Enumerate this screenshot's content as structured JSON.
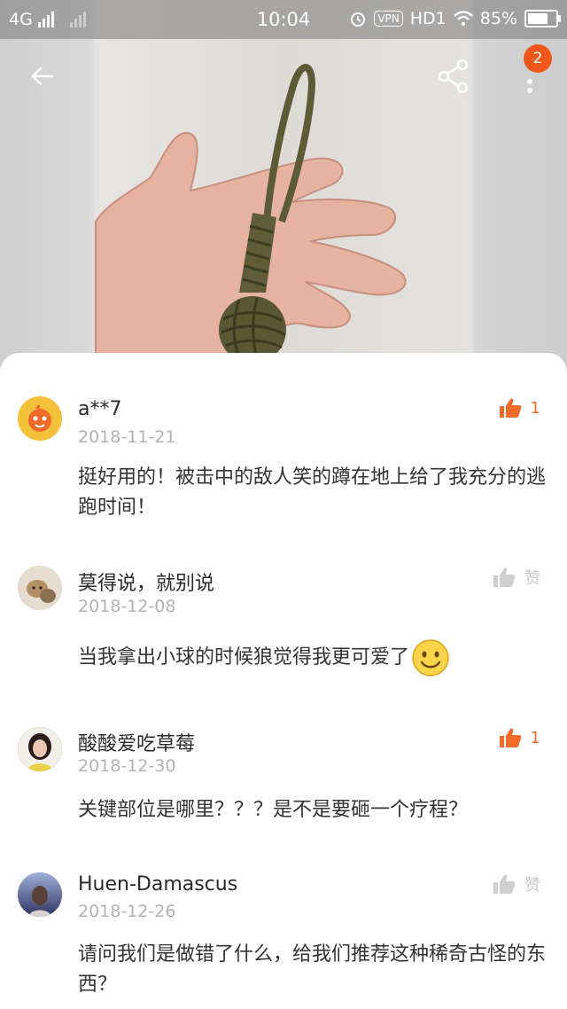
{
  "status_bar": {
    "network": "4G",
    "time": "10:04",
    "vpn": "VPN",
    "hd": "HD1",
    "battery": "85%",
    "battery_level": 0.85
  },
  "header": {
    "back_icon": "arrow-left-icon",
    "share_icon": "share-icon",
    "more_icon": "more-vertical-icon",
    "badge_count": "2"
  },
  "comments": [
    {
      "username": "a**7",
      "date": "2018-11-21",
      "text": "挺好用的！被击中的敌人笑的蹲在地上给了我充分的逃跑时间！",
      "like_label": "1",
      "liked": true
    },
    {
      "username": "莫得说，就别说",
      "date": "2018-12-08",
      "text": "当我拿出小球的时候狼觉得我更可爱了",
      "emoji": "smile-emoji",
      "like_label": "赞",
      "liked": false
    },
    {
      "username": "酸酸爱吃草莓",
      "date": "2018-12-30",
      "text": "关键部位是哪里？？？是不是要砸一个疗程？",
      "like_label": "1",
      "liked": true
    },
    {
      "username": "Huen-Damascus",
      "date": "2018-12-26",
      "text": "请问我们是做错了什么，给我们推荐这种稀奇古怪的东西？",
      "like_label": "赞",
      "liked": false
    }
  ],
  "colors": {
    "accent": "#f26b2a",
    "badge": "#f2581b",
    "muted": "#b3b3b3"
  }
}
